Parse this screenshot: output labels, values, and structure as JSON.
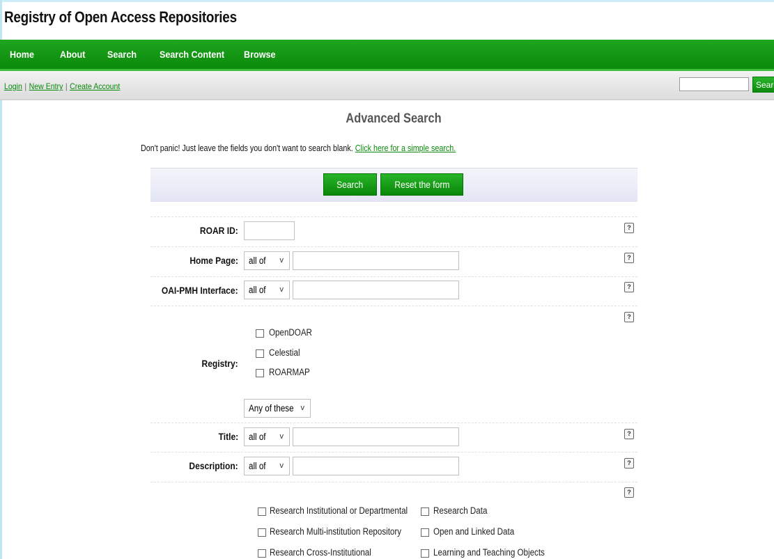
{
  "site": {
    "title": "Registry of Open Access Repositories"
  },
  "nav": {
    "items": [
      "Home",
      "About",
      "Search",
      "Search Content",
      "Browse"
    ]
  },
  "account_links": {
    "login": "Login",
    "new_entry": "New Entry",
    "create_account": "Create Account",
    "separator": "|"
  },
  "top_search": {
    "value": "",
    "button": "Search"
  },
  "page": {
    "heading": "Advanced Search",
    "intro_text": "Don't panic! Just leave the fields you don't want to search blank.",
    "intro_link": "Click here for a simple search."
  },
  "actions": {
    "search": "Search",
    "reset": "Reset the form"
  },
  "help_glyph": "?",
  "fields": {
    "roar_id": {
      "label": "ROAR ID:",
      "value": ""
    },
    "home_page": {
      "label": "Home Page:",
      "match": "all of",
      "value": ""
    },
    "oai_pmh": {
      "label": "OAI-PMH Interface:",
      "match": "all of",
      "value": ""
    },
    "registry": {
      "label": "Registry:",
      "options": [
        "OpenDOAR",
        "Celestial",
        "ROARMAP"
      ],
      "match": "Any of these"
    },
    "title": {
      "label": "Title:",
      "match": "all of",
      "value": ""
    },
    "description": {
      "label": "Description:",
      "match": "all of",
      "value": ""
    },
    "repository_type": {
      "left_options": [
        "Research Institutional or Departmental",
        "Research Multi-institution Repository",
        "Research Cross-Institutional"
      ],
      "right_options": [
        "Research Data",
        "Open and Linked Data",
        "Learning and Teaching Objects"
      ]
    }
  },
  "chevron_glyph": "v",
  "colors": {
    "nav_green": "#0a8a0a",
    "link_green": "#0a8a0a",
    "button_bar": "#e9ebf7"
  }
}
